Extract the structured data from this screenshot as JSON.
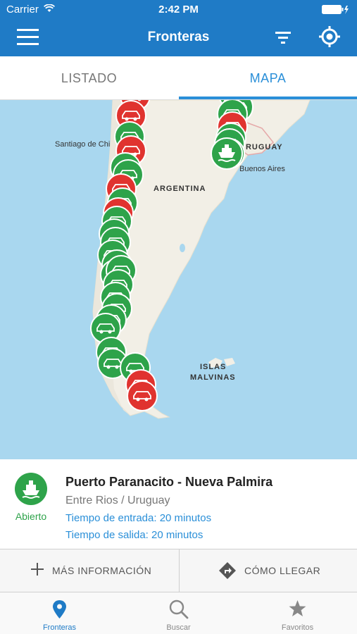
{
  "status_bar": {
    "carrier": "Carrier",
    "time": "2:42 PM"
  },
  "nav": {
    "title": "Fronteras",
    "icons": [
      "menu-icon",
      "filter-icon",
      "locate-icon"
    ]
  },
  "tabs": [
    {
      "label": "LISTADO",
      "selected": false
    },
    {
      "label": "MAPA",
      "selected": true
    }
  ],
  "map": {
    "labels": {
      "santiago": "Santiago de Chi",
      "uruguay": "URUGUAY",
      "buenos_aires": "Buenos Aires",
      "argentina": "ARGENTINA",
      "islas": "ISLAS",
      "malvinas": "MALVINAS"
    },
    "marker_colors": {
      "open": "#2ea34a",
      "closed": "#e0332f"
    }
  },
  "selected_crossing": {
    "name": "Puerto Paranacito - Nueva Palmira",
    "region": "Entre Rios / Uruguay",
    "status": "Abierto",
    "entrada": "Tiempo de entrada: 20 minutos",
    "salida": "Tiempo de salida: 20 minutos",
    "icon": "ship-icon"
  },
  "actions": {
    "more_info": "MÁS INFORMACIÓN",
    "directions": "CÓMO LLEGAR"
  },
  "tabbar": [
    {
      "label": "Fronteras",
      "icon": "pin-icon",
      "active": true
    },
    {
      "label": "Buscar",
      "icon": "search-icon",
      "active": false
    },
    {
      "label": "Favoritos",
      "icon": "star-icon",
      "active": false
    }
  ],
  "colors": {
    "primary": "#1f7bc6",
    "accent": "#2a8fd8",
    "open": "#2ea34a",
    "closed": "#e0332f"
  }
}
